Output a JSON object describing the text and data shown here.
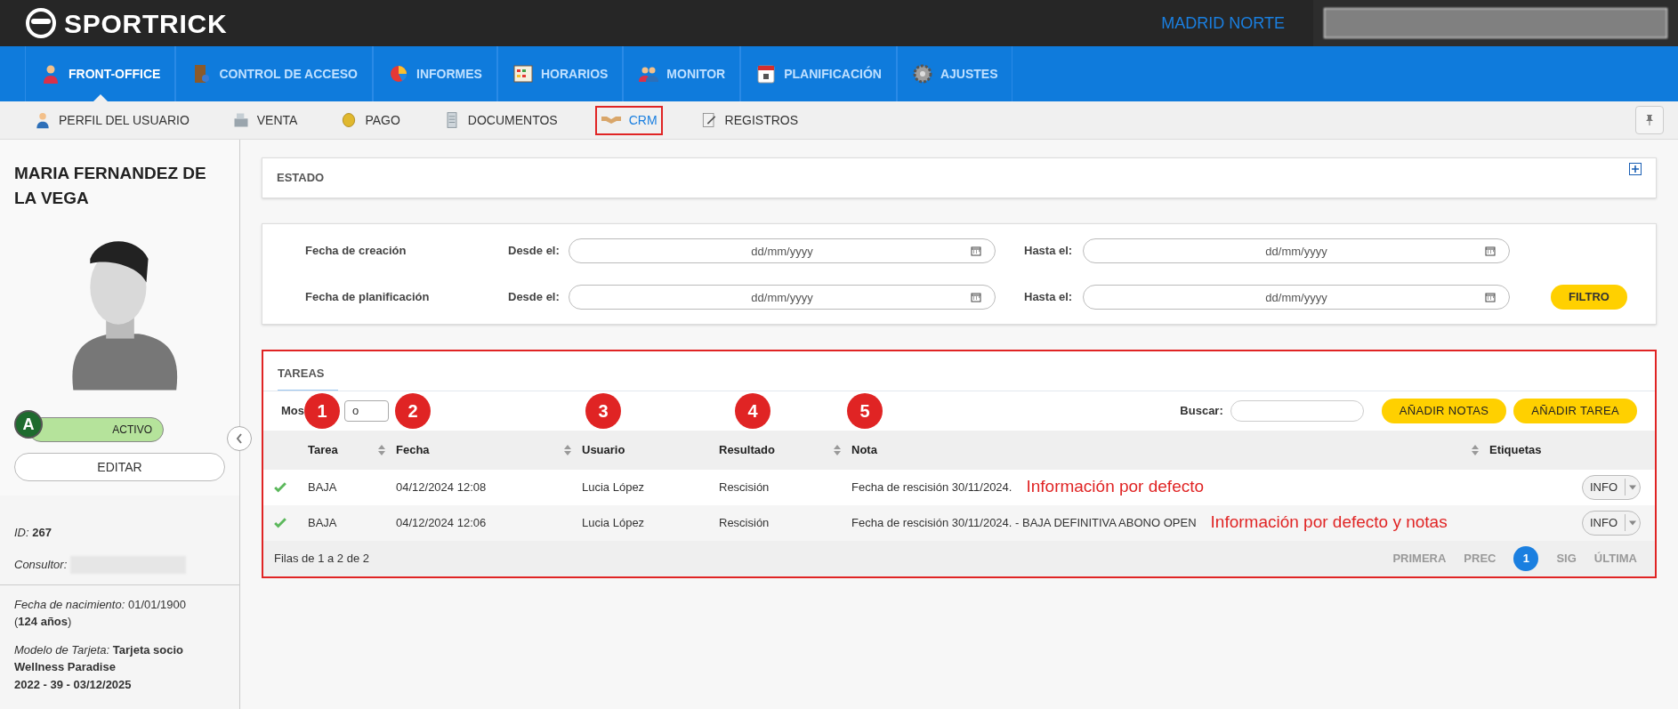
{
  "header": {
    "brand": "SPORTRICK",
    "location": "MADRID NORTE"
  },
  "main_nav": [
    {
      "label": "FRONT-OFFICE",
      "selected": true
    },
    {
      "label": "CONTROL DE ACCESO",
      "selected": false
    },
    {
      "label": "INFORMES",
      "selected": false
    },
    {
      "label": "HORARIOS",
      "selected": false
    },
    {
      "label": "MONITOR",
      "selected": false
    },
    {
      "label": "PLANIFICACIÓN",
      "selected": false
    },
    {
      "label": "AJUSTES",
      "selected": false
    }
  ],
  "sub_nav": [
    {
      "label": "PERFIL DEL USUARIO",
      "selected": false,
      "highlighted": false
    },
    {
      "label": "VENTA",
      "selected": false,
      "highlighted": false
    },
    {
      "label": "PAGO",
      "selected": false,
      "highlighted": false
    },
    {
      "label": "DOCUMENTOS",
      "selected": false,
      "highlighted": false
    },
    {
      "label": "CRM",
      "selected": true,
      "highlighted": true
    },
    {
      "label": "REGISTROS",
      "selected": false,
      "highlighted": false
    }
  ],
  "sidebar": {
    "name": "MARIA FERNANDEZ DE LA VEGA",
    "status_letter": "A",
    "status": "ACTIVO",
    "edit_button": "EDITAR",
    "id_label": "ID:",
    "id": "267",
    "consultor_label": "Consultor:",
    "birth_label": "Fecha de nacimiento:",
    "birth": "01/01/1900",
    "age": "(**124 años**)",
    "card_label": "Modelo de Tarjeta:",
    "card": "Tarjeta socio Wellness Paradise",
    "card_line": "2022 - 39 - 03/12/2025"
  },
  "estado": {
    "title": "ESTADO"
  },
  "filters": [
    {
      "label": "Fecha de creación",
      "from_label": "Desde el:",
      "from_placeholder": "dd/mm/yyyy",
      "to_label": "Hasta el:",
      "to_placeholder": "dd/mm/yyyy"
    },
    {
      "label": "Fecha de planificación",
      "from_label": "Desde el:",
      "from_placeholder": "dd/mm/yyyy",
      "to_label": "Hasta el:",
      "to_placeholder": "dd/mm/yyyy"
    }
  ],
  "filter_button": "FILTRO",
  "tareas": {
    "tab": "TAREAS",
    "show_label": "Mos",
    "show_value": "o",
    "search_label": "Buscar:",
    "buttons": [
      "AÑADIR NOTAS",
      "AÑADIR TAREA"
    ],
    "columns": [
      {
        "label": "Tarea",
        "sortable": true
      },
      {
        "label": "Fecha",
        "sortable": true
      },
      {
        "label": "Usuario",
        "sortable": false
      },
      {
        "label": "Resultado",
        "sortable": true
      },
      {
        "label": "Nota",
        "sortable": true
      },
      {
        "label": "Etiquetas",
        "sortable": false
      }
    ],
    "rows": [
      {
        "done": true,
        "tarea": "BAJA",
        "fecha": "04/12/2024 12:08",
        "usuario": "Lucia López",
        "resultado": "Rescisión",
        "nota": "Fecha de rescisión 30/11/2024.",
        "annotation": "Información por defecto",
        "tag": "INFO"
      },
      {
        "done": true,
        "tarea": "BAJA",
        "fecha": "04/12/2024 12:06",
        "usuario": "Lucia López",
        "resultado": "Rescisión",
        "nota": "Fecha de rescisión 30/11/2024. - BAJA DEFINITIVA ABONO OPEN",
        "annotation": "Información por defecto y notas",
        "tag": "INFO"
      }
    ],
    "footer": "Filas de 1 a 2 de 2",
    "pager": [
      {
        "label": "PRIMERA",
        "selected": false
      },
      {
        "label": "PREC",
        "selected": false
      },
      {
        "label": "1",
        "selected": true
      },
      {
        "label": "SIG",
        "selected": false
      },
      {
        "label": "ÚLTIMA",
        "selected": false
      }
    ]
  },
  "markers": [
    "1",
    "2",
    "3",
    "4",
    "5"
  ]
}
